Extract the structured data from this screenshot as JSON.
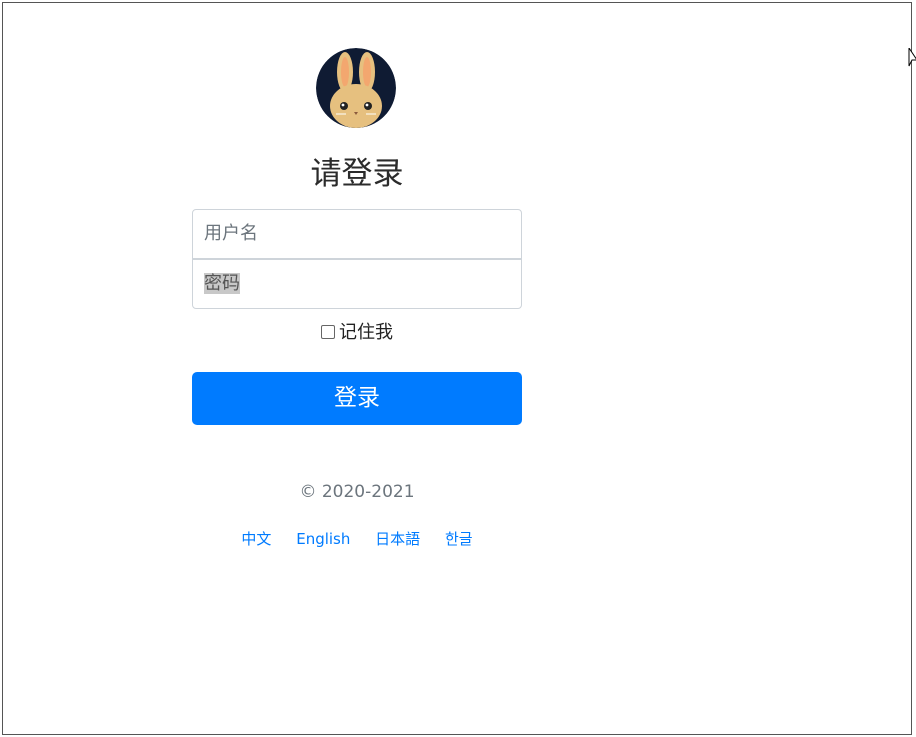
{
  "avatar": {
    "icon": "bunny-avatar",
    "background": "#0f1b33",
    "fur": "#e6c07f"
  },
  "login_form": {
    "title": "请登录",
    "username": {
      "value": "",
      "placeholder": "用户名"
    },
    "password": {
      "value": "",
      "placeholder": "密码"
    },
    "remember_label": "记住我",
    "remember_checked": false,
    "submit_label": "登录"
  },
  "footer": {
    "copyright": "© 2020-2021",
    "languages": [
      "中文",
      "English",
      "日本語",
      "한글"
    ]
  },
  "colors": {
    "primary": "#007bff",
    "border": "#ced4da",
    "muted": "#6c757d"
  }
}
